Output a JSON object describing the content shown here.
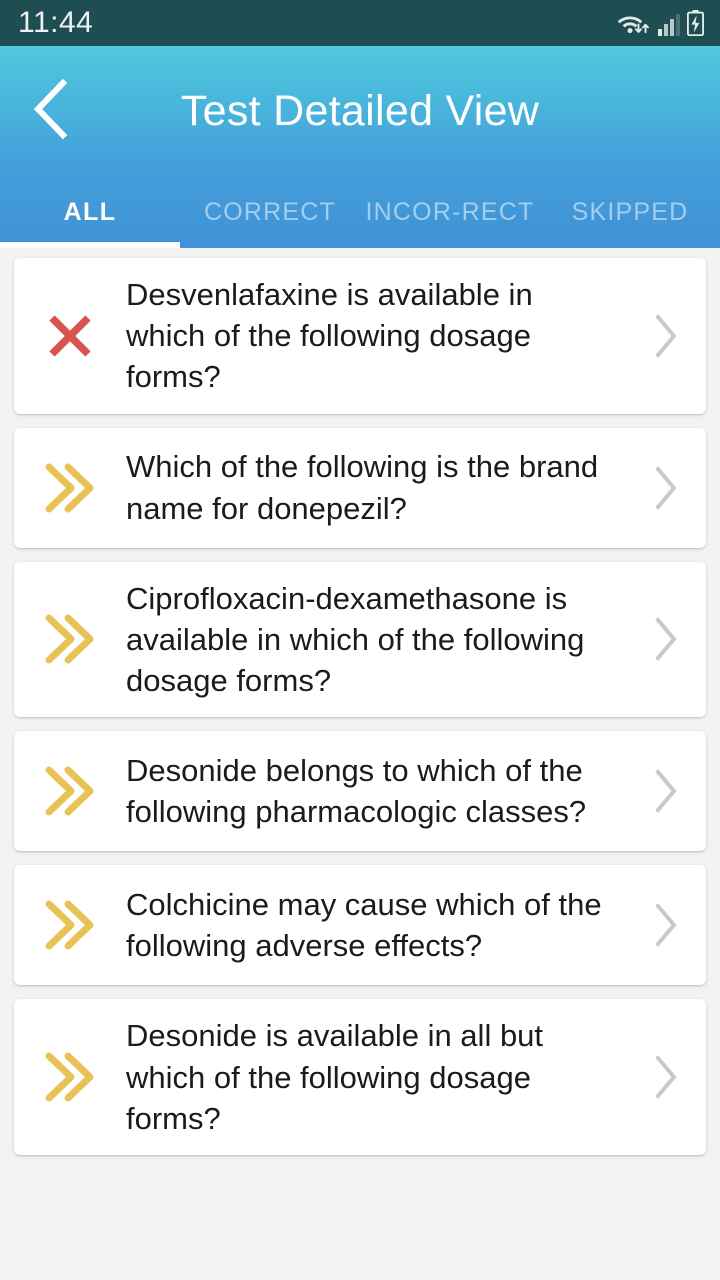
{
  "status_bar": {
    "clock": "11:44",
    "icons": [
      "wifi-icon",
      "cellular-signal-icon",
      "battery-charging-icon"
    ]
  },
  "header": {
    "title": "Test Detailed View",
    "back_icon": "back-chevron-icon"
  },
  "tabs": {
    "active_index": 0,
    "items": [
      {
        "label": "ALL"
      },
      {
        "label": "CORRECT"
      },
      {
        "label": "INCOR-RECT"
      },
      {
        "label": "SKIPPED"
      }
    ]
  },
  "colors": {
    "status_bar": "#1e4d52",
    "header_top": "#50c8dd",
    "header_bottom": "#4092d8",
    "page_background": "#f2f2f2",
    "card_background": "#ffffff",
    "incorrect": "#d9534f",
    "skipped": "#e8c255",
    "chevron": "#c9c9c9",
    "question_text": "#1b1b1b"
  },
  "questions": [
    {
      "status": "incorrect",
      "status_icon": "cross-icon",
      "text": "Desvenlafaxine is available in which of the following dosage forms?",
      "chevron_icon": "chevron-right-icon"
    },
    {
      "status": "skipped",
      "status_icon": "double-chevron-right-icon",
      "text": "Which of the following is the brand name for donepezil?",
      "chevron_icon": "chevron-right-icon"
    },
    {
      "status": "skipped",
      "status_icon": "double-chevron-right-icon",
      "text": "Ciprofloxacin-dexamethasone is available in which of the following dosage forms?",
      "chevron_icon": "chevron-right-icon"
    },
    {
      "status": "skipped",
      "status_icon": "double-chevron-right-icon",
      "text": "Desonide belongs to which of the following pharmacologic classes?",
      "chevron_icon": "chevron-right-icon"
    },
    {
      "status": "skipped",
      "status_icon": "double-chevron-right-icon",
      "text": "Colchicine may cause which of the following adverse effects?",
      "chevron_icon": "chevron-right-icon"
    },
    {
      "status": "skipped",
      "status_icon": "double-chevron-right-icon",
      "text": "Desonide is available in all but which of the following dosage forms?",
      "chevron_icon": "chevron-right-icon"
    }
  ]
}
